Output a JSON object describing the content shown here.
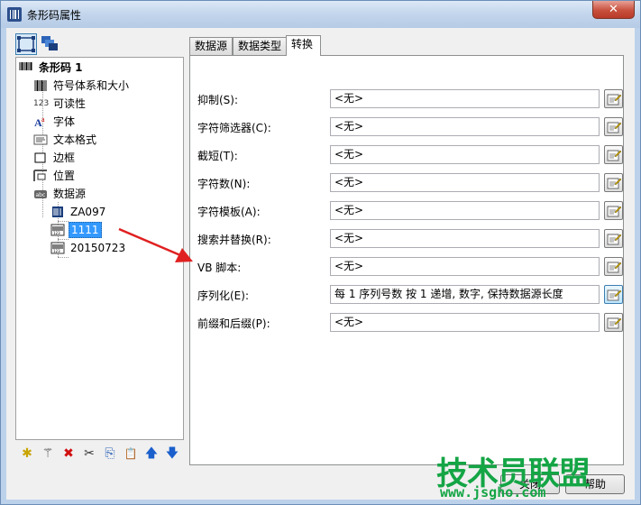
{
  "window": {
    "title": "条形码属性",
    "close_glyph": "✕"
  },
  "left": {
    "toolbar": [
      {
        "icon": "barcode-view-icon"
      },
      {
        "icon": "layers-view-icon"
      }
    ],
    "tree": {
      "root": {
        "label": "条形码 1",
        "icon": "barcode-icon"
      },
      "items": [
        {
          "label": "符号体系和大小",
          "icon": "barcode-icon"
        },
        {
          "label": "可读性",
          "icon": "number-123-icon",
          "icon_text": "123"
        },
        {
          "label": "字体",
          "icon": "font-icon"
        },
        {
          "label": "文本格式",
          "icon": "text-format-icon"
        },
        {
          "label": "边框",
          "icon": "border-icon"
        },
        {
          "label": "位置",
          "icon": "position-icon"
        },
        {
          "label": "数据源",
          "icon": "data-source-icon"
        }
      ],
      "children": [
        {
          "label": "ZA097",
          "icon": "fixed-data-icon"
        },
        {
          "label": "1111",
          "icon": "serial-data-icon",
          "selected": true
        },
        {
          "label": "20150723",
          "icon": "date-data-icon"
        }
      ]
    },
    "bottom_toolbar": [
      {
        "icon": "new-icon",
        "glyph": "✱"
      },
      {
        "icon": "wand-icon",
        "glyph": "⚚"
      },
      {
        "icon": "delete-icon",
        "glyph": "✖"
      },
      {
        "icon": "cut-icon",
        "glyph": "✂"
      },
      {
        "icon": "copy-icon",
        "glyph": "⎘"
      },
      {
        "icon": "paste-icon",
        "glyph": "📋"
      },
      {
        "icon": "move-up-icon",
        "glyph": "🡅"
      },
      {
        "icon": "move-down-icon",
        "glyph": "🡇"
      }
    ]
  },
  "tabs": [
    {
      "label": "数据源",
      "active": false
    },
    {
      "label": "数据类型",
      "active": false
    },
    {
      "label": "转换",
      "active": true
    }
  ],
  "properties": [
    {
      "label": "抑制(S):",
      "value": "<无>"
    },
    {
      "label": "字符筛选器(C):",
      "value": "<无>"
    },
    {
      "label": "截短(T):",
      "value": "<无>"
    },
    {
      "label": "字符数(N):",
      "value": "<无>"
    },
    {
      "label": "字符模板(A):",
      "value": "<无>"
    },
    {
      "label": "搜索并替换(R):",
      "value": "<无>"
    },
    {
      "label": "VB 脚本:",
      "value": "<无>"
    },
    {
      "label": "序列化(E):",
      "value": "每 1 序列号数 按 1 递增, 数字, 保持数据源长度",
      "highlighted": true
    },
    {
      "label": "前缀和后缀(P):",
      "value": "<无>"
    }
  ],
  "buttons": {
    "close": "关闭",
    "help": "帮助"
  },
  "watermark": {
    "title": "技术员联盟",
    "url": "www.jsgho.com"
  },
  "colors": {
    "accent_arrow": "#e02020",
    "selection": "#3399ff",
    "watermark": "#14a545"
  }
}
